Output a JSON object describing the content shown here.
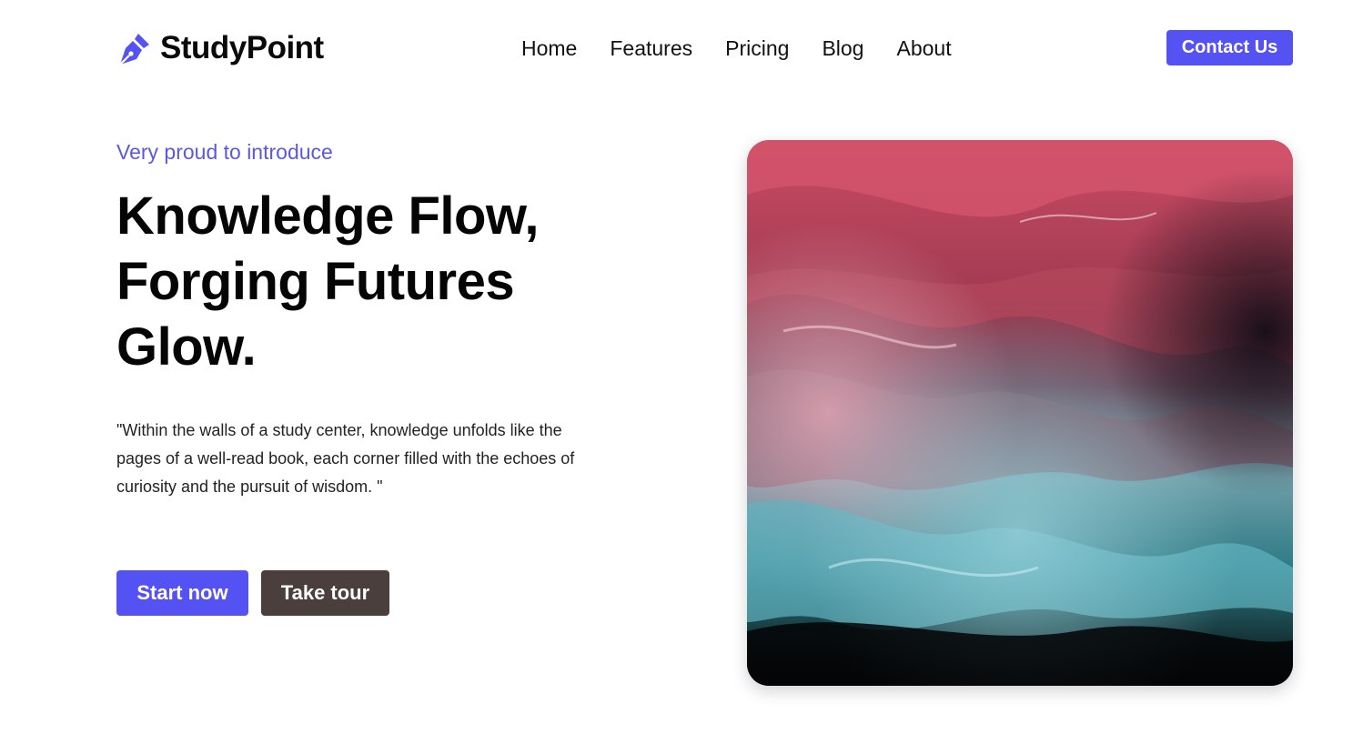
{
  "brand": {
    "name": "StudyPoint",
    "logo_icon": "pen-nib-icon",
    "accent_color": "#5552f3"
  },
  "nav": {
    "items": [
      "Home",
      "Features",
      "Pricing",
      "Blog",
      "About"
    ]
  },
  "header": {
    "contact_label": "Contact Us"
  },
  "hero": {
    "eyebrow": "Very proud to introduce",
    "headline_lines": [
      "Knowledge Flow,",
      "Forging Futures",
      "Glow."
    ],
    "quote": "\"Within the walls of a study center, knowledge unfolds like the pages of a well-read book, each corner filled with the echoes of curiosity and the pursuit of wisdom. \"",
    "primary_cta": "Start now",
    "secondary_cta": "Take tour",
    "secondary_color": "#4a3f3d"
  }
}
